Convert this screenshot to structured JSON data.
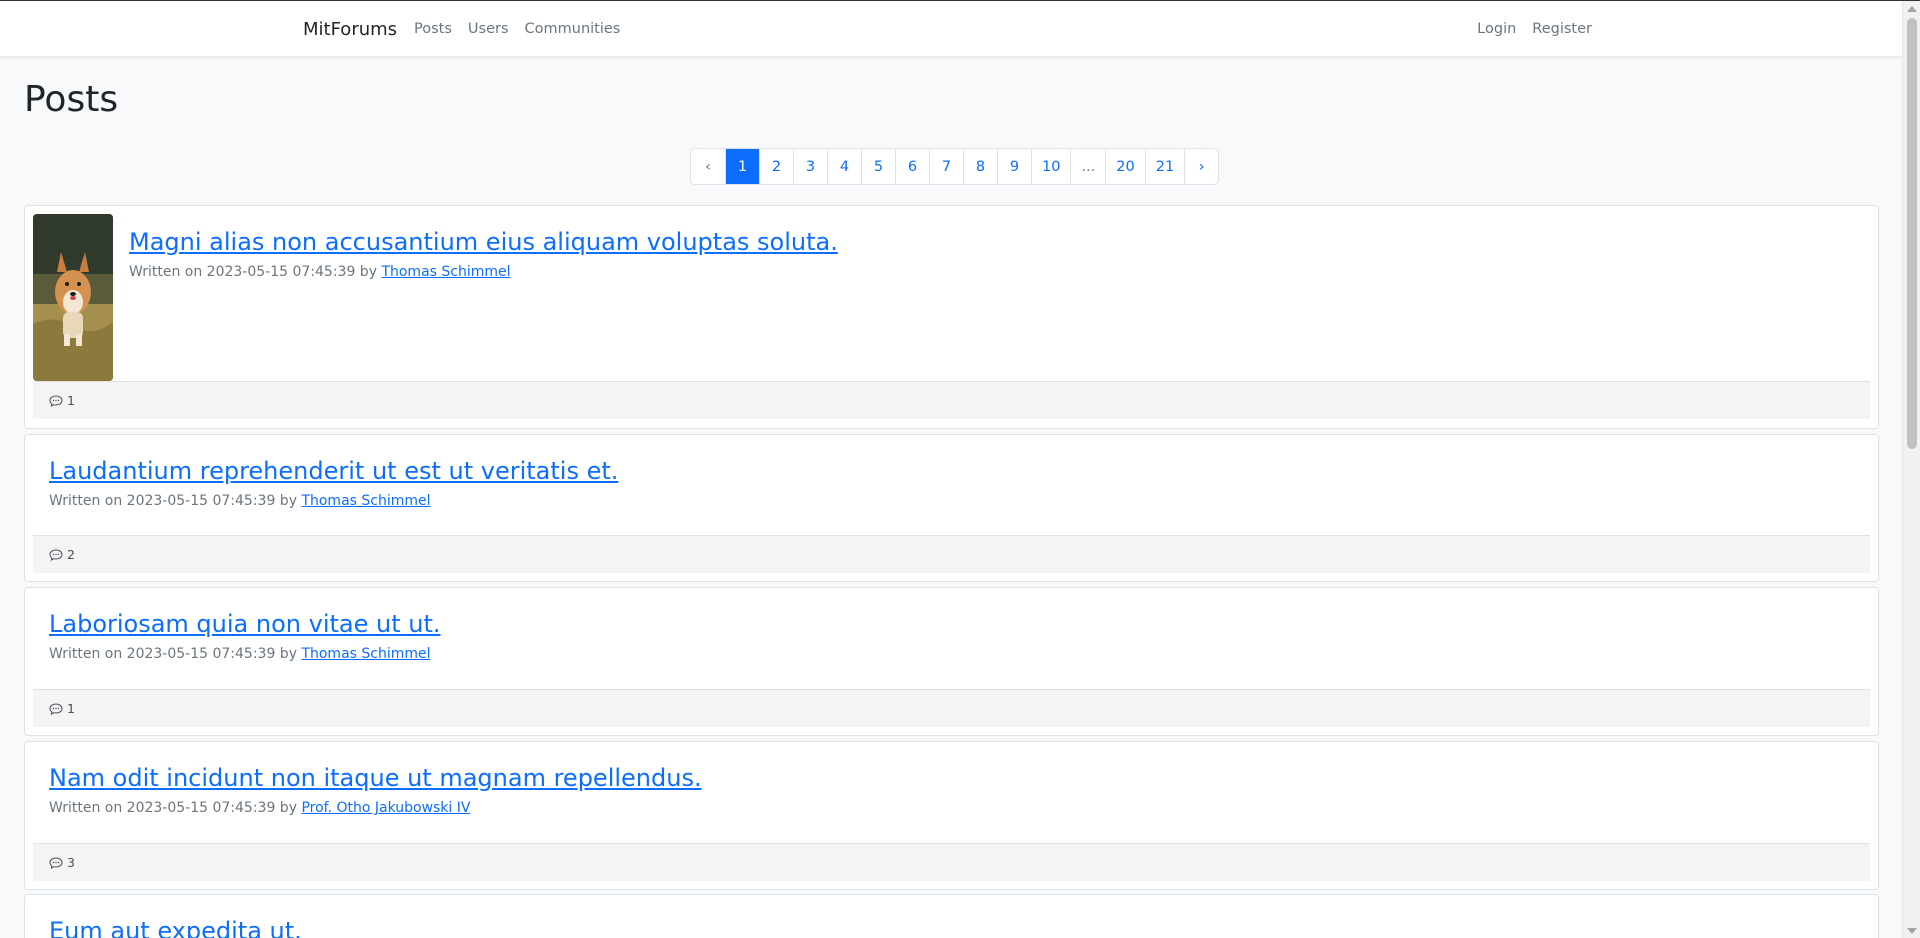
{
  "nav": {
    "brand": "MitForums",
    "left": [
      "Posts",
      "Users",
      "Communities"
    ],
    "right": [
      "Login",
      "Register"
    ]
  },
  "page_title": "Posts",
  "pagination": {
    "prev": "‹",
    "pages": [
      "1",
      "2",
      "3",
      "4",
      "5",
      "6",
      "7",
      "8",
      "9",
      "10",
      "...",
      "20",
      "21"
    ],
    "next": "›",
    "active": "1"
  },
  "colors": {
    "link": "#0d6efd",
    "muted": "#6c757d",
    "background": "#f8f9fa"
  },
  "posts": [
    {
      "title": "Magni alias non accusantium eius aliquam voluptas soluta.",
      "written_prefix": "Written on 2023-05-15 07:45:39 by",
      "author": "Thomas Schimmel",
      "comments": "1",
      "has_image": true,
      "image_icon": "corgi-dog-photo"
    },
    {
      "title": "Laudantium reprehenderit ut est ut veritatis et.",
      "written_prefix": "Written on 2023-05-15 07:45:39 by",
      "author": "Thomas Schimmel",
      "comments": "2",
      "has_image": false
    },
    {
      "title": "Laboriosam quia non vitae ut ut.",
      "written_prefix": "Written on 2023-05-15 07:45:39 by",
      "author": "Thomas Schimmel",
      "comments": "1",
      "has_image": false
    },
    {
      "title": "Nam odit incidunt non itaque ut magnam repellendus.",
      "written_prefix": "Written on 2023-05-15 07:45:39 by",
      "author": "Prof. Otho Jakubowski IV",
      "comments": "3",
      "has_image": false
    },
    {
      "title": "Eum aut expedita ut.",
      "has_image": false
    }
  ],
  "comment_icon": "speech-bubble-icon"
}
